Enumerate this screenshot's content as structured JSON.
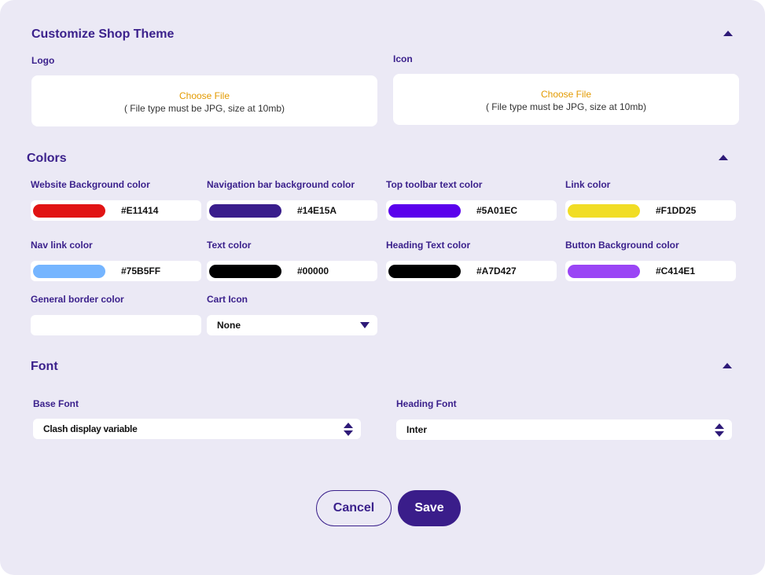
{
  "theme": {
    "title": "Customize Shop Theme",
    "logo": {
      "label": "Logo",
      "choose_label": "Choose File",
      "hint": "( File type must be JPG, size at 10mb)"
    },
    "icon": {
      "label": "Icon",
      "choose_label": "Choose File",
      "hint": "( File type must be JPG, size at 10mb)"
    }
  },
  "colors": {
    "title": "Colors",
    "items": [
      {
        "label": "Website Background color",
        "hex": "#E11414",
        "swatch": "#e11414"
      },
      {
        "label": "Navigation bar background color",
        "hex": "#14E15A",
        "swatch": "#3a1e8c"
      },
      {
        "label": "Top toolbar text color",
        "hex": "#5A01EC",
        "swatch": "#5a01ec"
      },
      {
        "label": "Link color",
        "hex": "#F1DD25",
        "swatch": "#f1dd25"
      },
      {
        "label": "Nav link color",
        "hex": "#75B5FF",
        "swatch": "#75b5ff"
      },
      {
        "label": "Text color",
        "hex": "#00000",
        "swatch": "#000000"
      },
      {
        "label": "Heading Text color",
        "hex": "#A7D427",
        "swatch": "#000000"
      },
      {
        "label": "Button  Background color",
        "hex": "#C414E1",
        "swatch": "#9a45f5"
      }
    ],
    "general_border": {
      "label": "General border color",
      "value": ""
    },
    "cart_icon": {
      "label": "Cart Icon",
      "value": "None"
    }
  },
  "font": {
    "title": "Font",
    "base": {
      "label": "Base Font",
      "value": "Clash display variable"
    },
    "heading": {
      "label": "Heading Font",
      "value": "Inter"
    }
  },
  "actions": {
    "cancel_label": "Cancel",
    "save_label": "Save"
  }
}
